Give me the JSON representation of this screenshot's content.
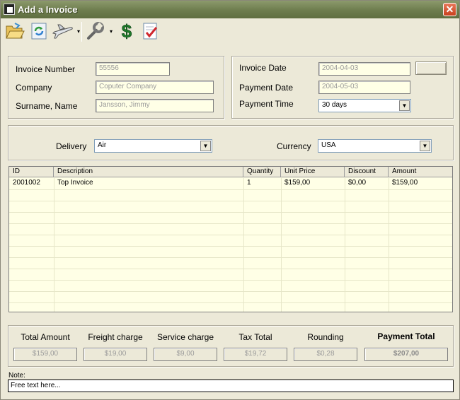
{
  "window": {
    "title": "Add a Invoice",
    "close_glyph": "✕"
  },
  "toolbar": {
    "icons": [
      "open-folder-icon",
      "refresh-icon",
      "airplane-icon",
      "wrench-icon",
      "dollar-icon",
      "approve-document-icon"
    ],
    "dropdown_glyph": "▾"
  },
  "invoice": {
    "number_label": "Invoice Number",
    "number_value": "55556",
    "company_label": "Company",
    "company_value": "Coputer Company",
    "name_label": "Surname, Name",
    "name_value": "Jansson, Jimmy",
    "date_label": "Invoice Date",
    "date_value": "2004-04-03",
    "payment_date_label": "Payment Date",
    "payment_date_value": "2004-05-03",
    "payment_time_label": "Payment Time",
    "payment_time_value": "30 days"
  },
  "shipping": {
    "delivery_label": "Delivery",
    "delivery_value": "Air",
    "currency_label": "Currency",
    "currency_value": "USA"
  },
  "items_table": {
    "columns": [
      "ID",
      "Description",
      "Quantity",
      "Unit Price",
      "Discount",
      "Amount"
    ],
    "rows": [
      [
        "2001002",
        "Top Invoice",
        "1",
        "$159,00",
        "$0,00",
        "$159,00"
      ]
    ]
  },
  "totals": {
    "total_amount_label": "Total Amount",
    "total_amount_value": "$159,00",
    "freight_label": "Freight charge",
    "freight_value": "$19,00",
    "service_label": "Service charge",
    "service_value": "$9,00",
    "tax_label": "Tax Total",
    "tax_value": "$19,72",
    "rounding_label": "Rounding",
    "rounding_value": "$0,28",
    "payment_total_label": "Payment Total",
    "payment_total_value": "$207,00"
  },
  "note": {
    "label": "Note:",
    "value": "Free text here..."
  },
  "colors": {
    "title_bar": "#6d7c4d",
    "window_bg": "#ece9d8",
    "field_bg": "#ffffe6",
    "close_button": "#c8411e"
  }
}
